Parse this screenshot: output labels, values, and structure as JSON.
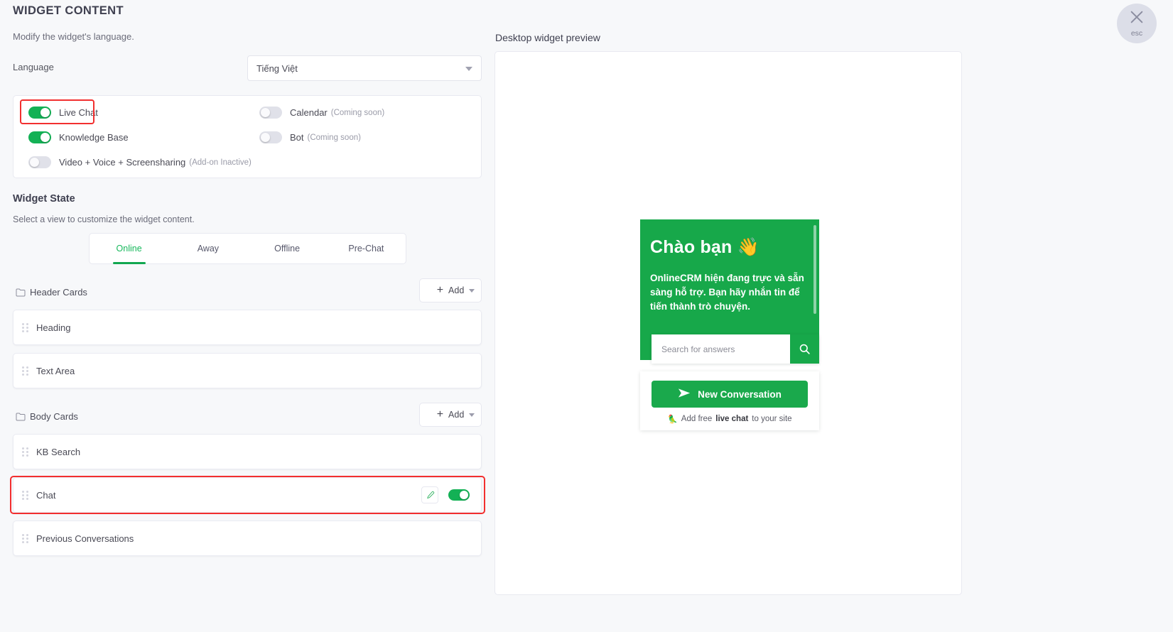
{
  "header": {
    "title": "WIDGET CONTENT",
    "subtitle": "Modify the widget's language."
  },
  "close": {
    "label": "esc",
    "icon": "close-icon"
  },
  "language": {
    "label": "Language",
    "value": "Tiếng Việt",
    "caret": "chevron-down-icon"
  },
  "channels": [
    {
      "label": "Live Chat",
      "note": "",
      "state": "on",
      "highlighted": true
    },
    {
      "label": "Knowledge Base",
      "note": "",
      "state": "on",
      "highlighted": false
    },
    {
      "label": "Video + Voice + Screensharing",
      "note": "(Add-on Inactive)",
      "state": "off",
      "highlighted": false
    },
    {
      "label": "Calendar",
      "note": "(Coming soon)",
      "state": "off",
      "highlighted": false
    },
    {
      "label": "Bot",
      "note": "(Coming soon)",
      "state": "off",
      "highlighted": false
    }
  ],
  "widget_state": {
    "title": "Widget State",
    "subtitle": "Select a view to customize the widget content.",
    "tabs": [
      {
        "label": "Online",
        "active": true
      },
      {
        "label": "Away",
        "active": false
      },
      {
        "label": "Offline",
        "active": false
      },
      {
        "label": "Pre-Chat",
        "active": false
      }
    ]
  },
  "sections": [
    {
      "name": "Header Cards",
      "add_label": "Add",
      "cards": [
        {
          "label": "Heading",
          "has_edit": false,
          "has_toggle": false
        },
        {
          "label": "Text Area",
          "has_edit": false,
          "has_toggle": false
        }
      ]
    },
    {
      "name": "Body Cards",
      "add_label": "Add",
      "cards": [
        {
          "label": "KB Search",
          "has_edit": false,
          "has_toggle": false
        },
        {
          "label": "Chat",
          "has_edit": true,
          "has_toggle": true,
          "toggle_state": "on",
          "highlighted": true
        },
        {
          "label": "Previous Conversations",
          "has_edit": false,
          "has_toggle": false
        }
      ]
    }
  ],
  "preview": {
    "title": "Desktop widget preview",
    "widget": {
      "greeting": "Chào bạn 👋",
      "message": "OnlineCRM hiện đang trực và sẵn sàng hỗ trợ. Bạn hãy nhắn tin để tiến thành trò chuyện.",
      "search_placeholder": "Search for answers",
      "search_icon": "search-icon",
      "new_conversation_label": "New Conversation",
      "new_conversation_icon": "send-icon",
      "footer_icon": "parrot-icon",
      "footer_prefix": "Add free ",
      "footer_bold": "live chat",
      "footer_suffix": " to your site"
    }
  },
  "colors": {
    "brand_green": "#17a84a",
    "toggle_on": "#13b155",
    "highlight_red": "#f22f2f",
    "tab_active": "#18b85c"
  }
}
